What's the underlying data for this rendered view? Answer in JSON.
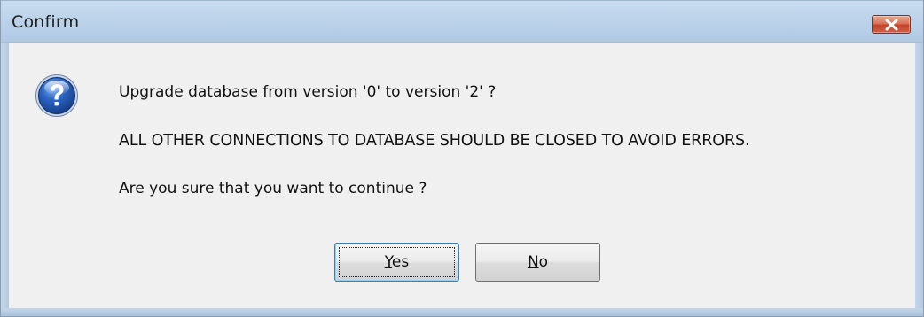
{
  "window": {
    "title": "Confirm",
    "close_icon": "close-icon"
  },
  "message": {
    "icon": "question-icon",
    "line1": "Upgrade database from version '0' to version '2' ?",
    "line2": "ALL OTHER CONNECTIONS TO DATABASE SHOULD BE CLOSED TO AVOID ERRORS.",
    "line3": "Are you sure that you want to continue ?"
  },
  "buttons": {
    "yes": {
      "mnemonic": "Y",
      "rest": "es"
    },
    "no": {
      "mnemonic": "N",
      "rest": "o"
    }
  },
  "colors": {
    "titlebar": "#bcd3ea",
    "close_button": "#c3442a",
    "client": "#f0f0f0",
    "icon_blue": "#1e4fa8"
  }
}
